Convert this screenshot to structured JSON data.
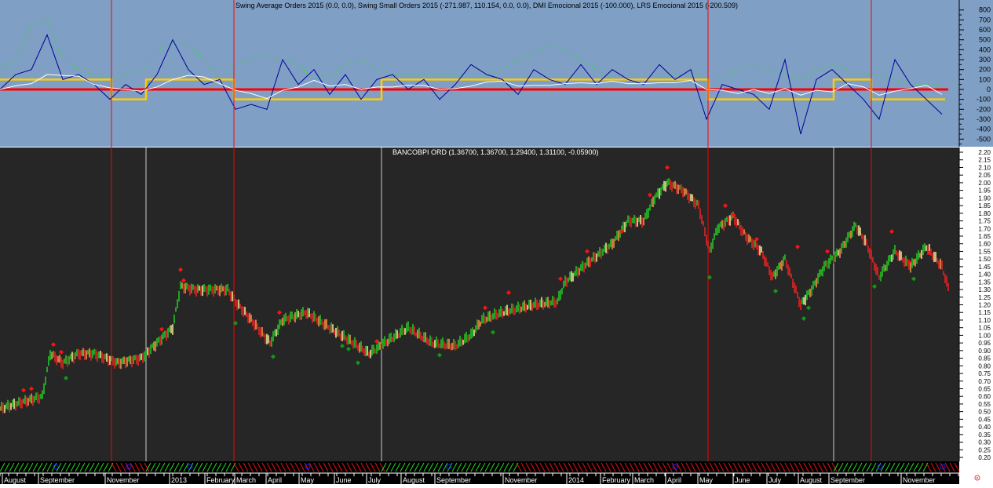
{
  "colors": {
    "upper_bg": "#7f9fc5",
    "lower_bg": "#262626",
    "up": "#22cc22",
    "down": "#ee2222",
    "neutral": "#ffee99",
    "orange": "#ff9944",
    "blue_line": "#000099",
    "yellow_line": "#ffcc00",
    "zero_line": "#ff0000",
    "green_dots": "#33dd33"
  },
  "chart_data": [
    {
      "type": "line",
      "title": "Swing Average Orders 2015 (0.0, 0.0), Swing Small Orders 2015 (-271.987, 110.154, 0.0, 0.0), DMI Emocional 2015 (-100.000), LRS Emocional 2015 (-200.509)",
      "ylim": [
        -550,
        850
      ],
      "yticks": [
        "800",
        "700",
        "600",
        "500",
        "400",
        "300",
        "200",
        "100",
        "0",
        "-100",
        "-200",
        "-300",
        "-400",
        "-500"
      ],
      "xlim": [
        0,
        611
      ],
      "series": [
        {
          "name": "Swing Small Orders",
          "color": "blue",
          "x_step": 10,
          "values": [
            0,
            150,
            200,
            550,
            100,
            150,
            50,
            -100,
            50,
            -50,
            150,
            500,
            200,
            50,
            100,
            -200,
            -150,
            -200,
            300,
            50,
            200,
            -50,
            150,
            -100,
            100,
            150,
            0,
            100,
            -100,
            50,
            250,
            150,
            100,
            -50,
            200,
            100,
            50,
            250,
            50,
            200,
            100,
            50,
            250,
            100,
            200,
            -300,
            50,
            0,
            -50,
            -200,
            300,
            -450,
            100,
            200,
            50,
            -100,
            -300,
            300,
            50,
            -100,
            -250
          ]
        },
        {
          "name": "Green dotted",
          "color": "green",
          "x_step": 10,
          "values": [
            200,
            300,
            650,
            700,
            300,
            200,
            150,
            100,
            150,
            200,
            400,
            480,
            450,
            300,
            100,
            250,
            300,
            350,
            300,
            250,
            100,
            150,
            250,
            300,
            200,
            150,
            150,
            150,
            150,
            150,
            100,
            150,
            200,
            300,
            350,
            450,
            400,
            300,
            200,
            100,
            100,
            100,
            100,
            150,
            200,
            100,
            100,
            200,
            250,
            200,
            150,
            100,
            200,
            250,
            200,
            150,
            150,
            100,
            50,
            50,
            50
          ]
        },
        {
          "name": "DMI Emocional",
          "color": "yellow",
          "steps": [
            [
              0,
              100
            ],
            [
              71,
              -100
            ],
            [
              93,
              100
            ],
            [
              149,
              -100
            ],
            [
              243,
              100
            ],
            [
              451,
              -100
            ],
            [
              531,
              100
            ],
            [
              555,
              -100
            ],
            [
              602,
              -100
            ]
          ]
        },
        {
          "name": "Swing Average Orders",
          "color": "red",
          "values": [
            0
          ]
        }
      ]
    },
    {
      "type": "line",
      "title": "BANCOBPI ORD (1.36700, 1.36700, 1.29400, 1.31100, -0.05900)",
      "ylim": [
        0.18,
        2.22
      ],
      "yticks": [
        "2.20",
        "2.15",
        "2.10",
        "2.05",
        "2.00",
        "1.95",
        "1.90",
        "1.85",
        "1.80",
        "1.75",
        "1.70",
        "1.65",
        "1.60",
        "1.55",
        "1.50",
        "1.45",
        "1.40",
        "1.35",
        "1.30",
        "1.25",
        "1.20",
        "1.15",
        "1.10",
        "1.05",
        "1.00",
        "0.95",
        "0.90",
        "0.85",
        "0.80",
        "0.75",
        "0.70",
        "0.65",
        "0.60",
        "0.55",
        "0.50",
        "0.45",
        "0.40",
        "0.35",
        "0.30",
        "0.25",
        "0.20"
      ],
      "xlim": [
        0,
        611
      ],
      "close": [
        [
          0,
          0.52
        ],
        [
          27,
          0.6
        ],
        [
          32,
          0.88
        ],
        [
          40,
          0.82
        ],
        [
          50,
          0.88
        ],
        [
          60,
          0.88
        ],
        [
          75,
          0.82
        ],
        [
          90,
          0.85
        ],
        [
          100,
          0.95
        ],
        [
          110,
          1.05
        ],
        [
          115,
          1.32
        ],
        [
          125,
          1.3
        ],
        [
          145,
          1.3
        ],
        [
          150,
          1.22
        ],
        [
          160,
          1.1
        ],
        [
          172,
          0.95
        ],
        [
          180,
          1.1
        ],
        [
          195,
          1.15
        ],
        [
          210,
          1.05
        ],
        [
          225,
          0.95
        ],
        [
          235,
          0.88
        ],
        [
          245,
          0.95
        ],
        [
          260,
          1.05
        ],
        [
          275,
          0.95
        ],
        [
          290,
          0.93
        ],
        [
          300,
          1.0
        ],
        [
          307,
          1.1
        ],
        [
          320,
          1.15
        ],
        [
          340,
          1.2
        ],
        [
          355,
          1.22
        ],
        [
          360,
          1.35
        ],
        [
          375,
          1.48
        ],
        [
          390,
          1.6
        ],
        [
          400,
          1.75
        ],
        [
          410,
          1.75
        ],
        [
          417,
          1.9
        ],
        [
          425,
          2.0
        ],
        [
          435,
          1.95
        ],
        [
          445,
          1.85
        ],
        [
          452,
          1.55
        ],
        [
          457,
          1.7
        ],
        [
          467,
          1.78
        ],
        [
          475,
          1.65
        ],
        [
          485,
          1.55
        ],
        [
          492,
          1.38
        ],
        [
          500,
          1.5
        ],
        [
          510,
          1.2
        ],
        [
          517,
          1.3
        ],
        [
          525,
          1.45
        ],
        [
          535,
          1.55
        ],
        [
          545,
          1.72
        ],
        [
          552,
          1.6
        ],
        [
          560,
          1.38
        ],
        [
          570,
          1.55
        ],
        [
          580,
          1.45
        ],
        [
          590,
          1.58
        ],
        [
          600,
          1.45
        ],
        [
          604,
          1.31
        ]
      ],
      "sell_signals": [
        [
          15,
          0.64
        ],
        [
          20,
          0.65
        ],
        [
          34,
          0.94
        ],
        [
          39,
          0.89
        ],
        [
          103,
          1.04
        ],
        [
          115,
          1.43
        ],
        [
          117,
          1.36
        ],
        [
          178,
          1.15
        ],
        [
          240,
          0.96
        ],
        [
          309,
          1.18
        ],
        [
          324,
          1.28
        ],
        [
          357,
          1.37
        ],
        [
          374,
          1.55
        ],
        [
          396,
          1.68
        ],
        [
          414,
          1.92
        ],
        [
          425,
          2.1
        ],
        [
          462,
          1.85
        ],
        [
          467,
          1.79
        ],
        [
          482,
          1.63
        ],
        [
          508,
          1.58
        ],
        [
          527,
          1.55
        ],
        [
          568,
          1.68
        ],
        [
          579,
          1.48
        ],
        [
          592,
          1.54
        ]
      ],
      "buy_signals": [
        [
          42,
          0.72
        ],
        [
          150,
          1.08
        ],
        [
          174,
          0.86
        ],
        [
          218,
          0.93
        ],
        [
          222,
          0.91
        ],
        [
          228,
          0.82
        ],
        [
          280,
          0.87
        ],
        [
          314,
          1.02
        ],
        [
          452,
          1.38
        ],
        [
          494,
          1.29
        ],
        [
          512,
          1.11
        ],
        [
          515,
          1.18
        ],
        [
          557,
          1.32
        ],
        [
          582,
          1.37
        ]
      ],
      "red_vlines": [
        71,
        149,
        451,
        555
      ],
      "white_vlines": [
        93,
        243,
        531
      ]
    }
  ],
  "xaxis": {
    "labels": [
      "August",
      "September",
      "November",
      "2013",
      "February",
      "March",
      "April",
      "May",
      "June",
      "July",
      "August",
      "September",
      "November",
      "2014",
      "February",
      "March",
      "April",
      "May",
      "June",
      "July",
      "August",
      "September",
      "November"
    ]
  },
  "regime_bars": [
    [
      "green",
      0,
      71
    ],
    [
      "red",
      71,
      93
    ],
    [
      "green",
      93,
      149
    ],
    [
      "red",
      149,
      243
    ],
    [
      "green",
      243,
      329
    ],
    [
      "red",
      329,
      531
    ],
    [
      "green",
      531,
      590
    ],
    [
      "red",
      590,
      611
    ]
  ],
  "corner_icon": "close-circle-icon"
}
